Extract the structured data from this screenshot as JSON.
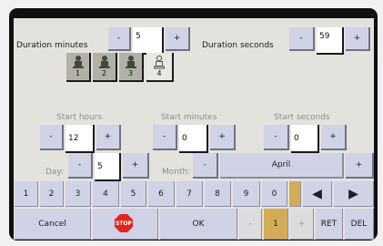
{
  "duration": {
    "minutes_label": "Duration minutes",
    "minutes_value": "5",
    "seconds_label": "Duration seconds",
    "seconds_value": "59"
  },
  "pumps": [
    {
      "number": "1",
      "selected": true
    },
    {
      "number": "2",
      "selected": true
    },
    {
      "number": "3",
      "selected": true
    },
    {
      "number": "4",
      "selected": false
    }
  ],
  "start": {
    "hours_label": "Start hours",
    "hours_value": "12",
    "minutes_label": "Start minutes",
    "minutes_value": "0",
    "seconds_label": "Start seconds",
    "seconds_value": "0"
  },
  "date": {
    "day_label": "Day:",
    "day_value": "5",
    "month_label": "Month:",
    "month_value": "April"
  },
  "controls": {
    "minus": "-",
    "plus": "+"
  },
  "keypad": {
    "digits": [
      "1",
      "2",
      "3",
      "4",
      "5",
      "6",
      "7",
      "8",
      "9",
      "0"
    ],
    "left_arrow": "◀",
    "right_arrow": "▶"
  },
  "bottom": {
    "cancel": "Cancel",
    "stop": "STOP",
    "ok": "OK",
    "stepper_minus": "-",
    "stepper_value": "1",
    "stepper_plus": "+",
    "ret": "RET",
    "del": "DEL"
  },
  "colors": {
    "button": "#d0d2e6",
    "screen": "#e3e2dc",
    "accent_gold": "#d2ad55",
    "stop_red": "#e0261f"
  }
}
